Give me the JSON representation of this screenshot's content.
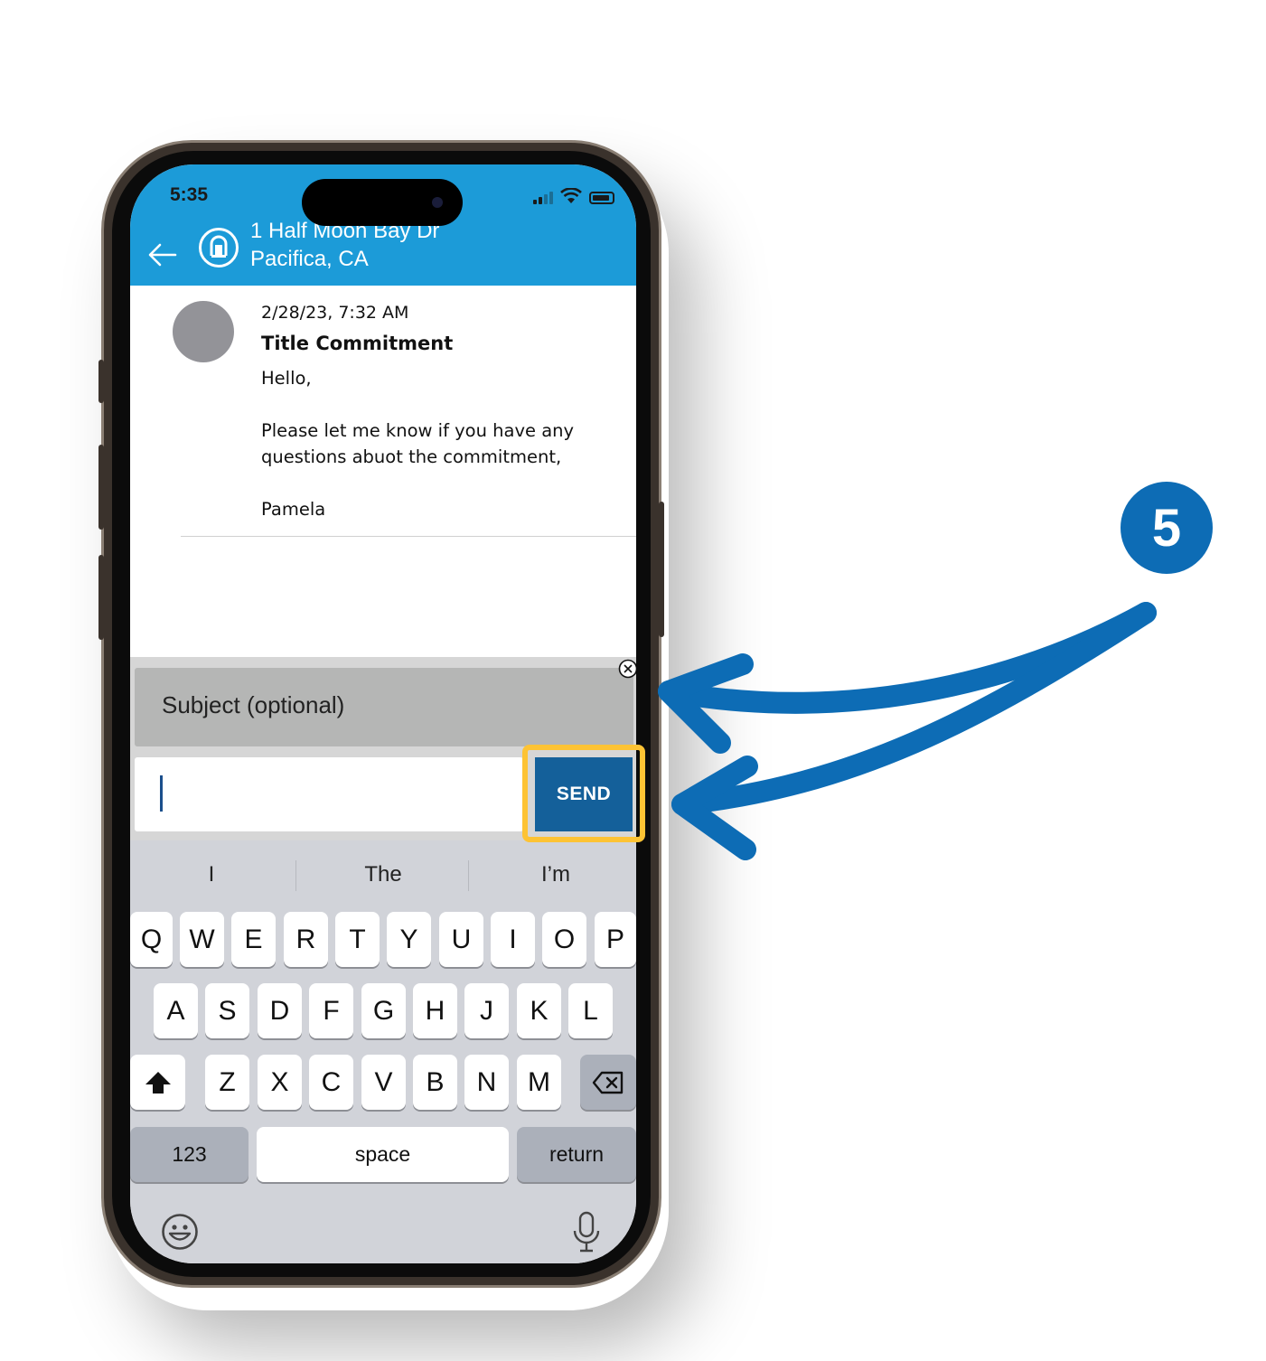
{
  "status_bar": {
    "time": "5:35"
  },
  "header": {
    "address_line1": "1 Half Moon Bay Dr",
    "address_line2": "Pacifica, CA"
  },
  "message": {
    "date": "2/28/23, 7:32 AM",
    "subject": "Title Commitment",
    "body": "Hello,\n\nPlease let me know if you have any questions abuot the commitment,\n\nPamela"
  },
  "compose": {
    "subject_placeholder": "Subject (optional)",
    "send_label": "SEND"
  },
  "keyboard": {
    "suggestions": [
      "I",
      "The",
      "I’m"
    ],
    "row1": [
      "Q",
      "W",
      "E",
      "R",
      "T",
      "Y",
      "U",
      "I",
      "O",
      "P"
    ],
    "row2": [
      "A",
      "S",
      "D",
      "F",
      "G",
      "H",
      "J",
      "K",
      "L"
    ],
    "row3": [
      "Z",
      "X",
      "C",
      "V",
      "B",
      "N",
      "M"
    ],
    "numbers_label": "123",
    "space_label": "space",
    "return_label": "return"
  },
  "annotation": {
    "step_number": "5"
  },
  "colors": {
    "header_blue": "#1c9bd8",
    "send_blue": "#14609a",
    "highlight_yellow": "#fdc334",
    "annotation_blue": "#0d6cb5"
  }
}
